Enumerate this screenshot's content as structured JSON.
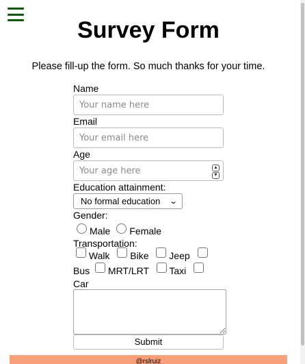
{
  "page": {
    "title": "Survey Form",
    "intro": "Please fill-up the form. So much thanks for your time."
  },
  "form": {
    "name": {
      "label": "Name",
      "placeholder": "Your name here"
    },
    "email": {
      "label": "Email",
      "placeholder": "Your email here"
    },
    "age": {
      "label": "Age",
      "placeholder": "Your age here"
    },
    "education": {
      "label": "Education attainment:",
      "selected": "No formal education"
    },
    "gender": {
      "label": "Gender:",
      "options": [
        "Male",
        "Female"
      ]
    },
    "transportation": {
      "label": "Transportation:",
      "options": [
        "Walk",
        "Bike",
        "Jeep",
        "Bus",
        "MRT/LRT",
        "Taxi",
        "Car"
      ]
    },
    "submit_label": "Submit"
  },
  "footer": {
    "text": "@rslruiz"
  },
  "colors": {
    "menu_icon": "#0a5a0a",
    "footer_bg": "#f9a07a"
  }
}
